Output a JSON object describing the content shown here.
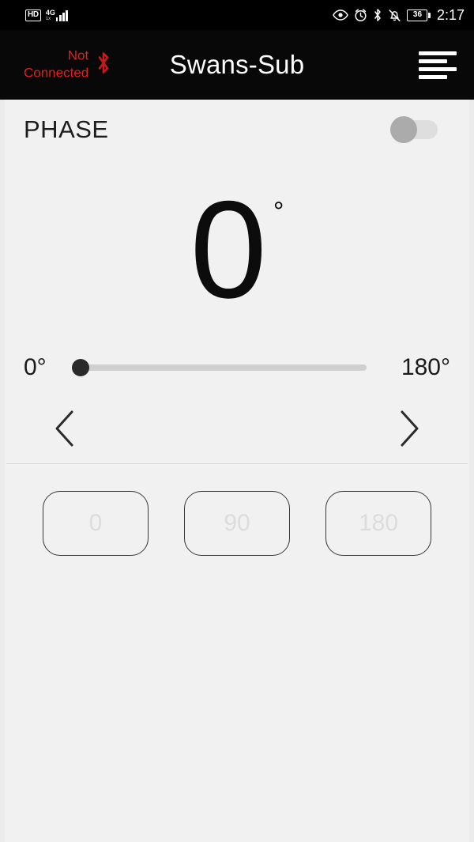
{
  "status_bar": {
    "hd_badge": "HD",
    "network_gen": "4G",
    "network_sub": "1x",
    "signal_bars": 4,
    "icons": [
      "eye-icon",
      "alarm-clock-icon",
      "bluetooth-icon",
      "bell-muted-icon"
    ],
    "battery_level": "36",
    "time": "2:17"
  },
  "app_bar": {
    "connection_line1": "Not",
    "connection_line2": "Connected",
    "connection_color": "#e02020",
    "bluetooth_icon": "bluetooth-icon",
    "title": "Swans-Sub",
    "menu_icon": "hamburger-menu-icon"
  },
  "phase_section": {
    "label": "PHASE",
    "toggle_state": "off",
    "toggle_knob_color": "#ababab",
    "toggle_track_color": "#dedede"
  },
  "readout": {
    "value": "0",
    "unit": "°"
  },
  "slider": {
    "min_label": "0°",
    "max_label": "180°",
    "min": 0,
    "max": 180,
    "value": 0,
    "thumb_color": "#2a2a2a",
    "track_color": "#cfcfcf"
  },
  "stepper": {
    "prev_icon": "chevron-left-icon",
    "next_icon": "chevron-right-icon"
  },
  "presets": [
    {
      "label": "0"
    },
    {
      "label": "90"
    },
    {
      "label": "180"
    }
  ]
}
